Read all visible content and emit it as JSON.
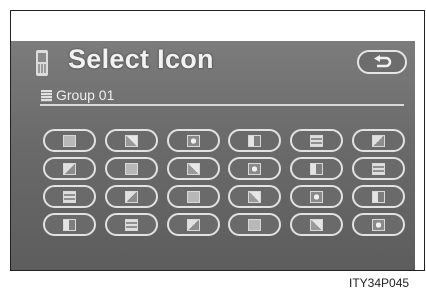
{
  "screen": {
    "title": "Select Icon",
    "group_label": "Group 01",
    "back_icon": "back-arrow-icon"
  },
  "icon_grid": {
    "rows": 4,
    "columns": 6,
    "items": [
      {
        "icon": "contact-icon-01"
      },
      {
        "icon": "contact-icon-02"
      },
      {
        "icon": "contact-icon-03"
      },
      {
        "icon": "contact-icon-04"
      },
      {
        "icon": "contact-icon-05"
      },
      {
        "icon": "contact-icon-06"
      },
      {
        "icon": "contact-icon-07"
      },
      {
        "icon": "contact-icon-08"
      },
      {
        "icon": "contact-icon-09"
      },
      {
        "icon": "contact-icon-10"
      },
      {
        "icon": "contact-icon-11"
      },
      {
        "icon": "contact-icon-12"
      },
      {
        "icon": "contact-icon-13"
      },
      {
        "icon": "contact-icon-14"
      },
      {
        "icon": "contact-icon-15"
      },
      {
        "icon": "contact-icon-16"
      },
      {
        "icon": "contact-icon-17"
      },
      {
        "icon": "contact-icon-18"
      },
      {
        "icon": "contact-icon-19"
      },
      {
        "icon": "contact-icon-20"
      },
      {
        "icon": "contact-icon-21"
      },
      {
        "icon": "contact-icon-22"
      },
      {
        "icon": "contact-icon-23"
      },
      {
        "icon": "contact-icon-24"
      }
    ]
  },
  "caption": "ITY34P045",
  "colors": {
    "screen_bg": "#6a6a6a",
    "button_border": "#e2e2e2",
    "text": "#f2f2f2"
  }
}
